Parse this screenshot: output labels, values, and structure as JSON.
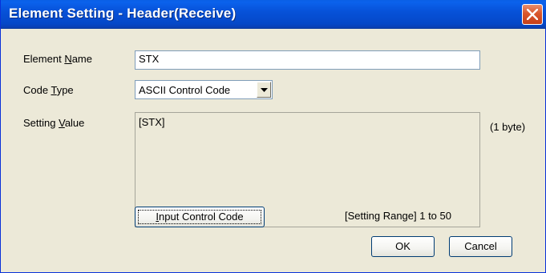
{
  "window": {
    "title": "Element Setting - Header(Receive)"
  },
  "form": {
    "element_name_label_pre": "Element ",
    "element_name_label_acc": "N",
    "element_name_label_post": "ame",
    "element_name_value": "STX",
    "code_type_label_pre": "Code ",
    "code_type_label_acc": "T",
    "code_type_label_post": "ype",
    "code_type_selected": "ASCII Control Code",
    "setting_value_label_pre": "Setting ",
    "setting_value_label_acc": "V",
    "setting_value_label_post": "alue",
    "setting_value_content": "[STX]",
    "byte_count": "(1 byte)",
    "setting_range": "[Setting Range] 1 to 50"
  },
  "buttons": {
    "input_control_code_acc": "I",
    "input_control_code_rest": "nput Control Code",
    "ok": "OK",
    "cancel": "Cancel"
  },
  "icons": {
    "close": "close-icon",
    "dropdown": "chevron-down-icon"
  },
  "colors": {
    "titlebar": "#0752D9",
    "dialog_bg": "#ECE9D8",
    "close_button": "#D9562B"
  }
}
